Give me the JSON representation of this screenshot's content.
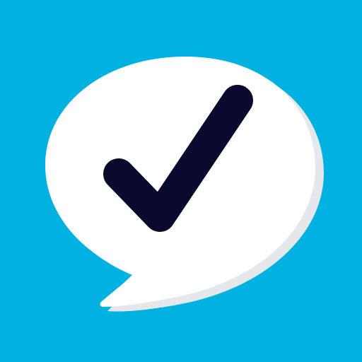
{
  "icon": {
    "name": "check-speech-bubble-app-icon",
    "glyph": "check-icon",
    "colors": {
      "background": "#00B1E1",
      "bubble": "#FFFFFF",
      "bubble_shadow": "#E4E7EC",
      "check": "#0A0A2E"
    }
  }
}
